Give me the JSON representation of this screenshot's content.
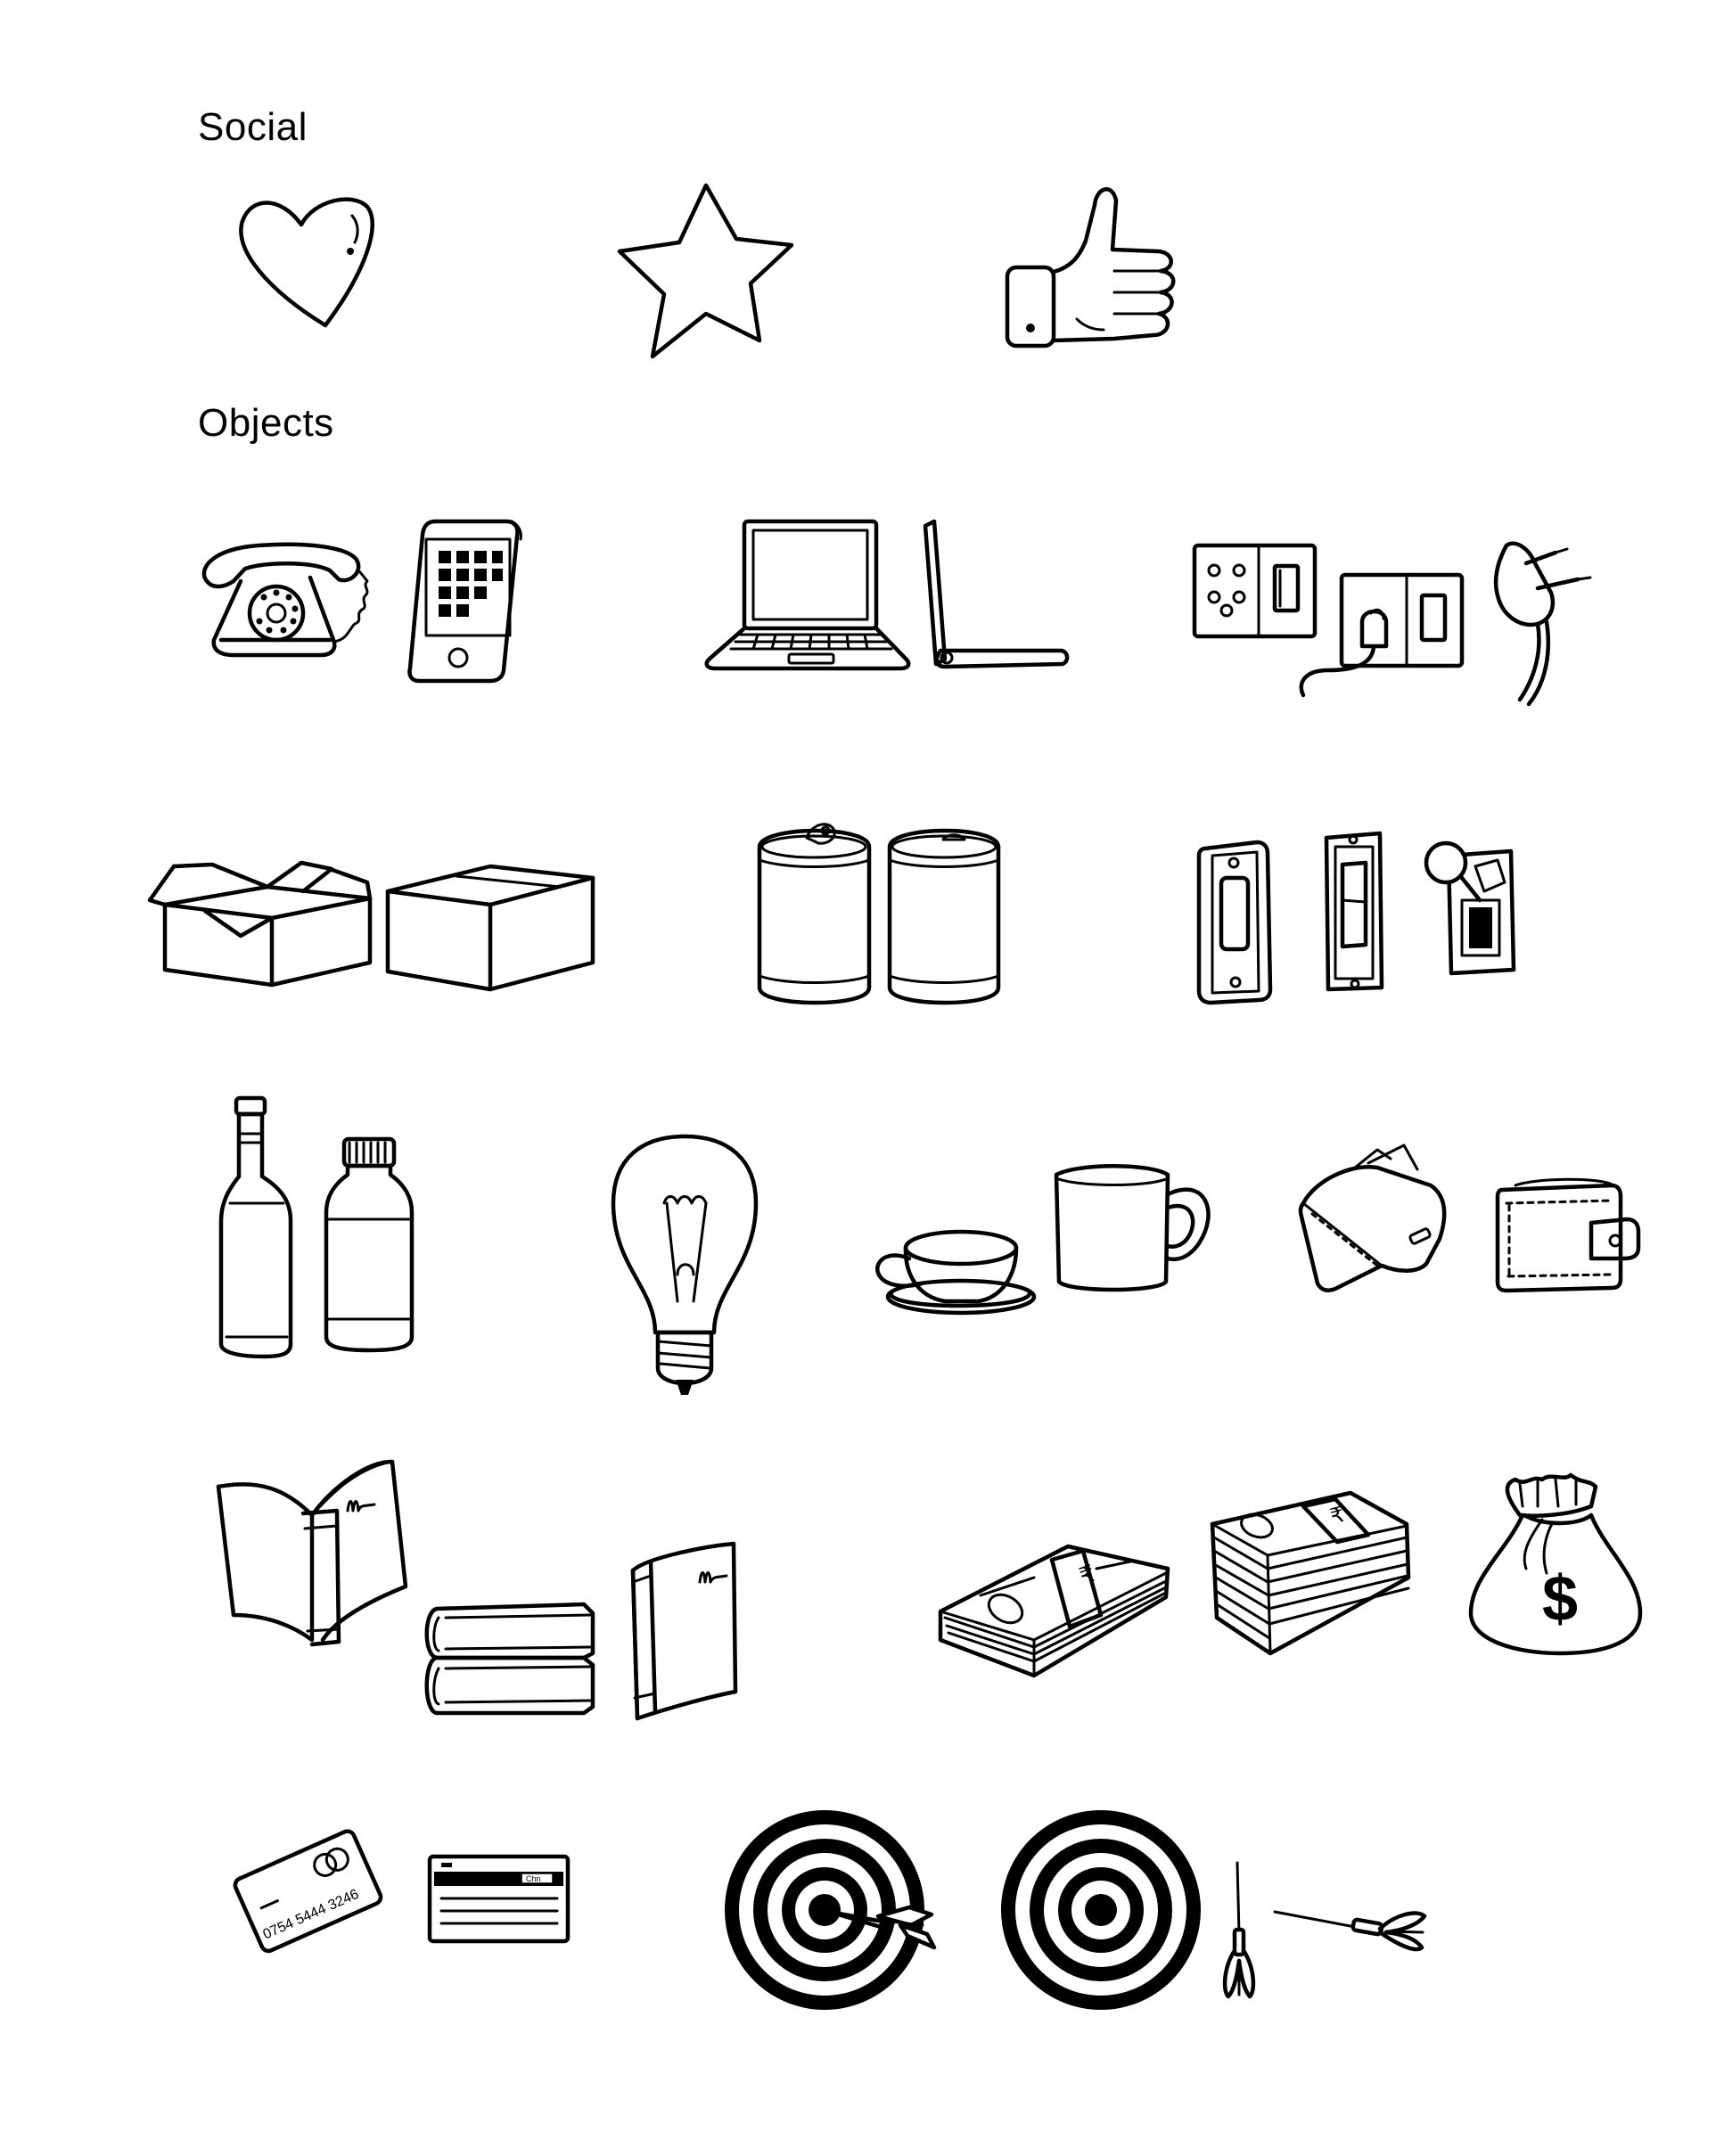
{
  "sections": {
    "social": {
      "title": "Social"
    },
    "objects": {
      "title": "Objects"
    }
  },
  "icons": {
    "social": [
      "heart-icon",
      "star-icon",
      "thumbs-up-icon"
    ],
    "objects": [
      "rotary-telephone-icon",
      "smartphone-icon",
      "laptop-open-icon",
      "laptop-side-icon",
      "power-socket-icon",
      "plugged-socket-icon",
      "power-plug-icon",
      "open-box-icon",
      "closed-box-icon",
      "soda-can-open-icon",
      "soda-can-icon",
      "rocker-switch-icon",
      "light-switch-icon",
      "toggle-switch-icon",
      "wine-bottle-icon",
      "water-bottle-icon",
      "light-bulb-icon",
      "teacup-icon",
      "mug-icon",
      "wallet-open-icon",
      "wallet-icon",
      "open-book-icon",
      "stacked-books-icon",
      "standing-book-icon",
      "cash-stack-rupee-icon",
      "cash-bundle-rupee-icon",
      "money-bag-dollar-icon",
      "credit-card-icon",
      "debit-card-icon",
      "dartboard-hit-icon",
      "dartboard-icon",
      "dart-vertical-icon",
      "dart-horizontal-icon"
    ]
  },
  "card_text": {
    "number": "0754 5444 3246",
    "brand": "Chn"
  },
  "currency_symbols": {
    "rupee": "₹",
    "dollar": "$"
  },
  "colors": {
    "background": "#ffffff",
    "ink": "#000000"
  }
}
